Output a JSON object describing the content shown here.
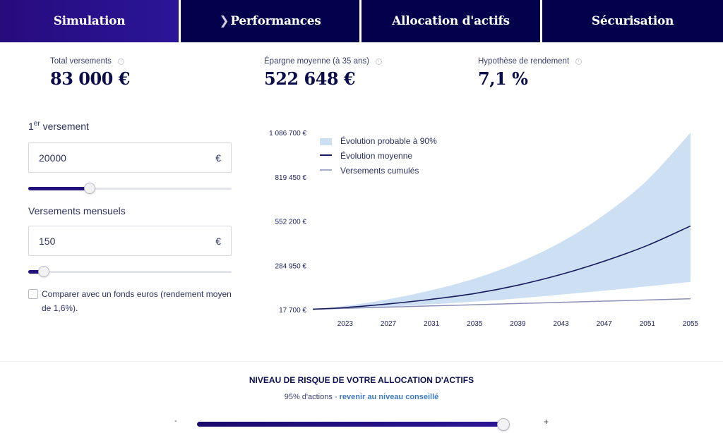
{
  "tabs": [
    {
      "label": "Simulation",
      "active": true,
      "chevron": false
    },
    {
      "label": "Performances",
      "active": false,
      "chevron": true
    },
    {
      "label": "Allocation d'actifs",
      "active": false,
      "chevron": false
    },
    {
      "label": "Sécurisation",
      "active": false,
      "chevron": false
    }
  ],
  "stats": {
    "total": {
      "label": "Total versements",
      "value": "83 000 €"
    },
    "epargne": {
      "label": "Épargne moyenne (à 35 ans)",
      "value": "522 648 €"
    },
    "hypothese": {
      "label": "Hypothèse de rendement",
      "value": "7,1 %"
    }
  },
  "first_payment": {
    "label_num": "1",
    "label_sup": "er",
    "label_rest": " versement",
    "value": "20000",
    "currency": "€",
    "slider_fraction": 0.29
  },
  "monthly": {
    "label": "Versements mensuels",
    "value": "150",
    "currency": "€",
    "slider_fraction": 0.05
  },
  "compare": {
    "checked": false,
    "label": "Comparer avec un fonds euros (rendement moyen de 1,6%)."
  },
  "risk": {
    "title": "NIVEAU DE RISQUE DE VOTRE ALLOCATION D'ACTIFS",
    "subtitle": "95% d'actions",
    "separator": " - ",
    "link": "revenir au niveau conseillé",
    "minus": "-",
    "plus": "+",
    "slider_fraction": 0.95
  },
  "colors": {
    "accent": "#22117a",
    "tab_bg": "#03004c",
    "band": "#cddff3",
    "mean_line": "#161a5a",
    "versements_line": "#8c8fb8"
  },
  "chart_data": {
    "type": "area",
    "title": "",
    "xlabel": "",
    "ylabel": "",
    "x_ticks": [
      "2023",
      "2027",
      "2031",
      "2035",
      "2039",
      "2043",
      "2047",
      "2051",
      "2055"
    ],
    "y_ticks": [
      "17 700 €",
      "284 950 €",
      "552 200 €",
      "819 450 €",
      "1 086 700 €"
    ],
    "y_tick_values": [
      17700,
      284950,
      552200,
      819450,
      1086700
    ],
    "xlim": [
      2020,
      2055
    ],
    "ylim": [
      17700,
      1086700
    ],
    "grid": false,
    "legend_position": "top-left",
    "legend": [
      {
        "label": "Évolution probable à 90%",
        "kind": "band"
      },
      {
        "label": "Évolution moyenne",
        "kind": "mean"
      },
      {
        "label": "Versements cumulés",
        "kind": "versements"
      }
    ],
    "x": [
      2020,
      2023,
      2027,
      2031,
      2035,
      2039,
      2043,
      2047,
      2051,
      2055
    ],
    "series": [
      {
        "name": "Évolution probable à 90% (haut)",
        "values": [
          20000,
          40000,
          80000,
          135000,
          205000,
          300000,
          425000,
          590000,
          800000,
          1086700
        ]
      },
      {
        "name": "Évolution probable à 90% (bas)",
        "values": [
          20000,
          23000,
          35000,
          50000,
          66000,
          85000,
          108000,
          132000,
          158000,
          185000
        ]
      },
      {
        "name": "Évolution moyenne",
        "values": [
          20000,
          30000,
          52000,
          80000,
          115000,
          165000,
          230000,
          310000,
          405000,
          522648
        ]
      },
      {
        "name": "Versements cumulés",
        "values": [
          20000,
          25400,
          32600,
          39800,
          47000,
          54200,
          61400,
          68600,
          75800,
          83000
        ]
      }
    ]
  }
}
